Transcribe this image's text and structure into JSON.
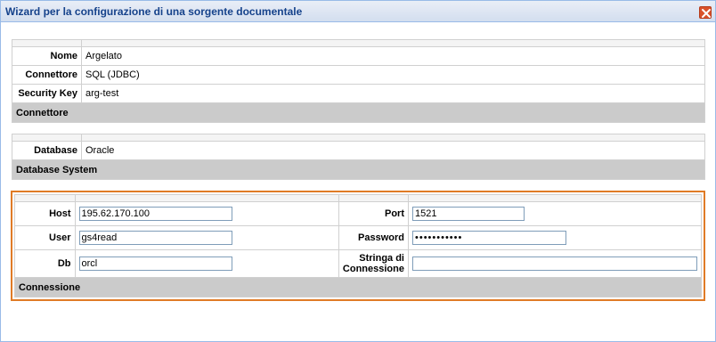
{
  "window": {
    "title": "Wizard per la configurazione di una sorgente documentale"
  },
  "source": {
    "rows": [
      {
        "label": "Nome",
        "value": "Argelato"
      },
      {
        "label": "Connettore",
        "value": "SQL (JDBC)"
      },
      {
        "label": "Security Key",
        "value": "arg-test"
      }
    ],
    "section_label": "Connettore"
  },
  "database": {
    "rows": [
      {
        "label": "Database",
        "value": "Oracle"
      }
    ],
    "section_label": "Database System"
  },
  "connection": {
    "host_label": "Host",
    "host_value": "195.62.170.100",
    "port_label": "Port",
    "port_value": "1521",
    "user_label": "User",
    "user_value": "gs4read",
    "password_label": "Password",
    "password_value": "•••••••••••",
    "db_label": "Db",
    "db_value": "orcl",
    "conn_string_label_line1": "Stringa di",
    "conn_string_label_line2": "Connessione",
    "conn_string_value": "",
    "section_label": "Connessione"
  },
  "colors": {
    "highlight_border": "#e07b26",
    "section_bg": "#cbcbcb",
    "title_text": "#15428b"
  }
}
